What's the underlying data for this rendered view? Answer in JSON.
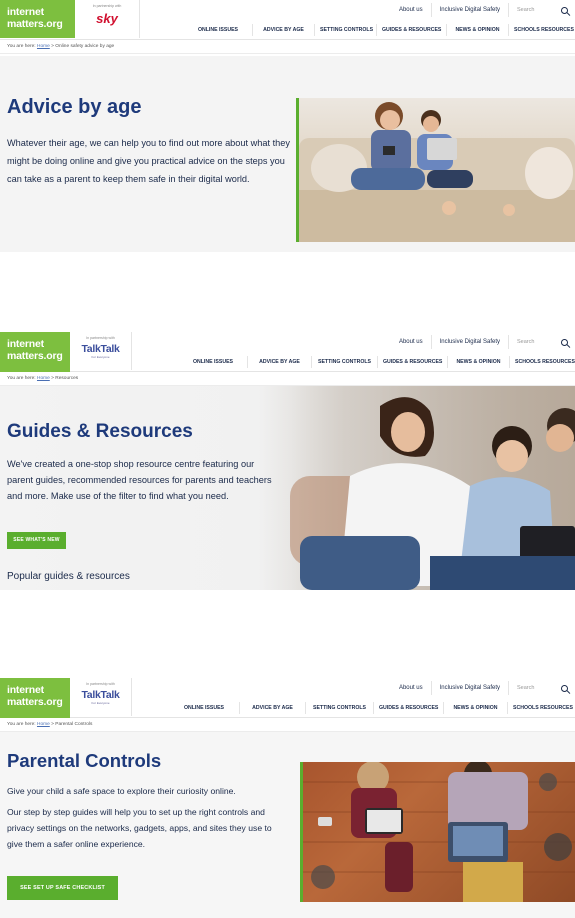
{
  "header": {
    "logo_line1": "internet",
    "logo_line2": "matters.org",
    "partner_label": "In partnership with",
    "top_links": [
      "About us",
      "Inclusive Digital Safety"
    ],
    "search_placeholder": "Search",
    "nav": [
      "ONLINE ISSUES",
      "ADVICE BY AGE",
      "SETTING CONTROLS",
      "GUIDES & RESOURCES",
      "NEWS & OPINION",
      "SCHOOLS RESOURCES"
    ],
    "crumb_prefix": "You are here:",
    "crumb_home": "Home",
    "crumb_sep": ">"
  },
  "panel1": {
    "partner_brand": "sky",
    "crumb_current": "Online safety advice by age",
    "title": "Advice by age",
    "desc": "Whatever their age, we can help you to find out more about what they might be doing online and give you practical advice on the steps you can take as a parent to keep them safe in their digital world."
  },
  "panel2": {
    "partner_brand": "TalkTalk",
    "partner_sub": "For Everyone",
    "crumb_current": "Resources",
    "title": "Guides & Resources",
    "desc": "We've created a one-stop shop resource centre featuring our parent guides, recommended resources for parents and teachers and more. Make use of the filter to find what you need.",
    "button": "SEE WHAT'S NEW",
    "popular": "Popular guides & resources"
  },
  "panel3": {
    "partner_brand": "TalkTalk",
    "partner_sub": "For Everyone",
    "crumb_current": "Parental Controls",
    "title": "Parental Controls",
    "desc1": "Give your child a safe space to explore their curiosity online.",
    "desc2": "Our step by step guides will help you to set up the right controls and privacy settings on the networks, gadgets, apps, and sites they use to give them a safer online experience.",
    "button": "SEE SET UP SAFE CHECKLIST"
  },
  "colors": {
    "brand_green": "#7dbf3f",
    "accent_green": "#5aae2e",
    "title_navy": "#1e3a7b",
    "text": "#1b2a4a"
  }
}
